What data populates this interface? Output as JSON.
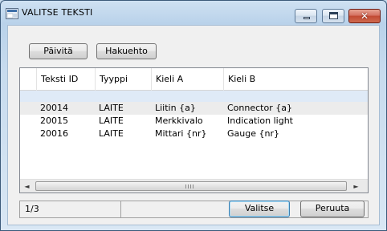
{
  "window": {
    "title": "VALITSE TEKSTI",
    "controls": {
      "minimize": "minimize",
      "maximize": "maximize",
      "close": "✕"
    }
  },
  "toolbar": {
    "refresh_label": "Päivitä",
    "search_criteria_label": "Hakuehto"
  },
  "grid": {
    "columns": [
      "Teksti ID",
      "Tyyppi",
      "Kieli A",
      "Kieli B"
    ],
    "rows": [
      [
        "",
        "",
        "",
        ""
      ],
      [
        "20014",
        "LAITE",
        "Liitin {a}",
        "Connector {a}"
      ],
      [
        "20015",
        "LAITE",
        "Merkkivalo",
        "Indication light"
      ],
      [
        "20016",
        "LAITE",
        "Mittari {nr}",
        "Gauge {nr}"
      ]
    ]
  },
  "scrollbar": {
    "left_arrow": "◄",
    "right_arrow": "►"
  },
  "status": {
    "record_position": "1/3"
  },
  "actions": {
    "select_label": "Valitse",
    "cancel_label": "Peruuta"
  },
  "colors": {
    "selection_row": "#dfeaf7",
    "alternate_row": "#ececec",
    "close_button": "#c14a33"
  },
  "icons": {
    "app": "app-icon",
    "minimize": "minimize-icon",
    "maximize": "maximize-icon",
    "close": "close-icon"
  }
}
